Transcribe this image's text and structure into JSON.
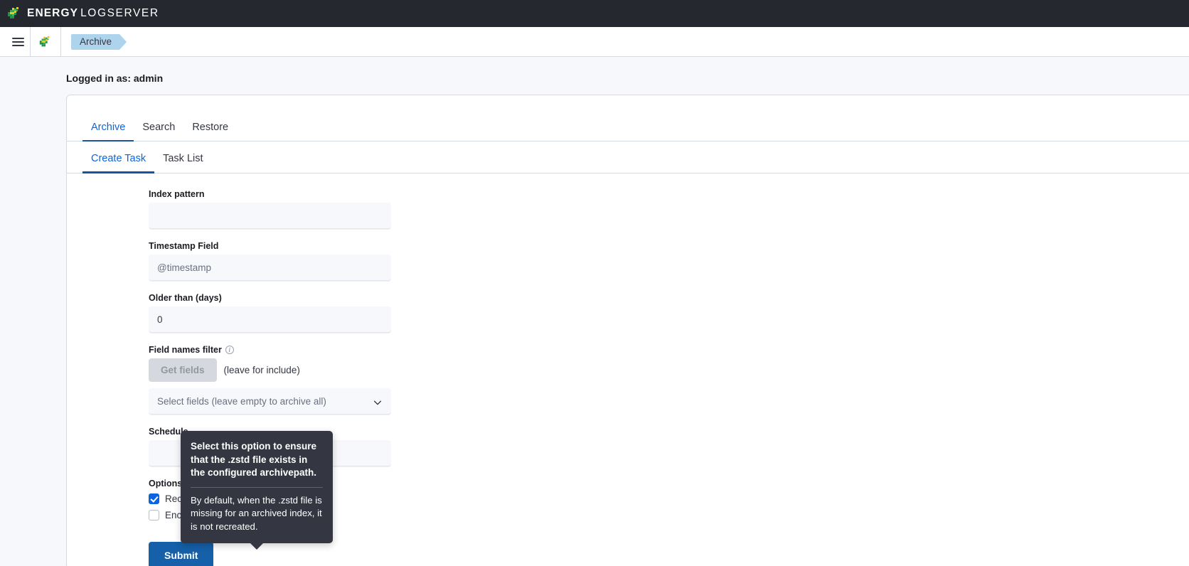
{
  "topbar": {
    "brand_bold": "ENERGY",
    "brand_light": "LOGSERVER",
    "logo_icon": "energy-logserver-logo-icon"
  },
  "subnav": {
    "menu_icon": "hamburger-menu-icon",
    "app_logo_icon": "energy-logserver-app-icon",
    "breadcrumb": "Archive"
  },
  "page": {
    "logged_in": "Logged in as: admin"
  },
  "tabs_primary": [
    {
      "label": "Archive",
      "active": true
    },
    {
      "label": "Search",
      "active": false
    },
    {
      "label": "Restore",
      "active": false
    }
  ],
  "tabs_secondary": [
    {
      "label": "Create Task",
      "active": true
    },
    {
      "label": "Task List",
      "active": false
    }
  ],
  "form": {
    "index_pattern": {
      "label": "Index pattern",
      "value": "",
      "placeholder": ""
    },
    "timestamp_field": {
      "label": "Timestamp Field",
      "value": "",
      "placeholder": "@timestamp"
    },
    "older_than": {
      "label": "Older than (days)",
      "value": "0",
      "placeholder": "0"
    },
    "field_names_filter": {
      "label": "Field names filter",
      "info_icon": "info-circle-icon",
      "get_button": "Get fields",
      "hint": "(leave for include)",
      "select_value": "Select fields (leave empty to archive all)",
      "chevron_icon": "chevron-down-icon"
    },
    "schedule": {
      "label": "Schedule",
      "value": "",
      "placeholder": ""
    },
    "options": {
      "label": "Options",
      "items": [
        {
          "label": "Recreate missing files",
          "checked": true,
          "info_icon": "info-circle-icon"
        },
        {
          "label": "Encrypt archives",
          "checked": false,
          "info_icon": "info-circle-icon"
        }
      ]
    },
    "submit_label": "Submit"
  },
  "tooltip": {
    "title": "Select this option to ensure that the .zstd file exists in the configured archivepath.",
    "body": "By default, when the .zstd file is missing for an archived index, it is not recreated."
  },
  "colors": {
    "topbar_bg": "#25282f",
    "accent_blue": "#0b64dd",
    "tab_underline": "#17549e",
    "submit_blue": "#1560a8",
    "breadcrumb_badge": "#aed3ec",
    "tooltip_bg": "#343741",
    "page_bg": "#f7f8fc"
  }
}
